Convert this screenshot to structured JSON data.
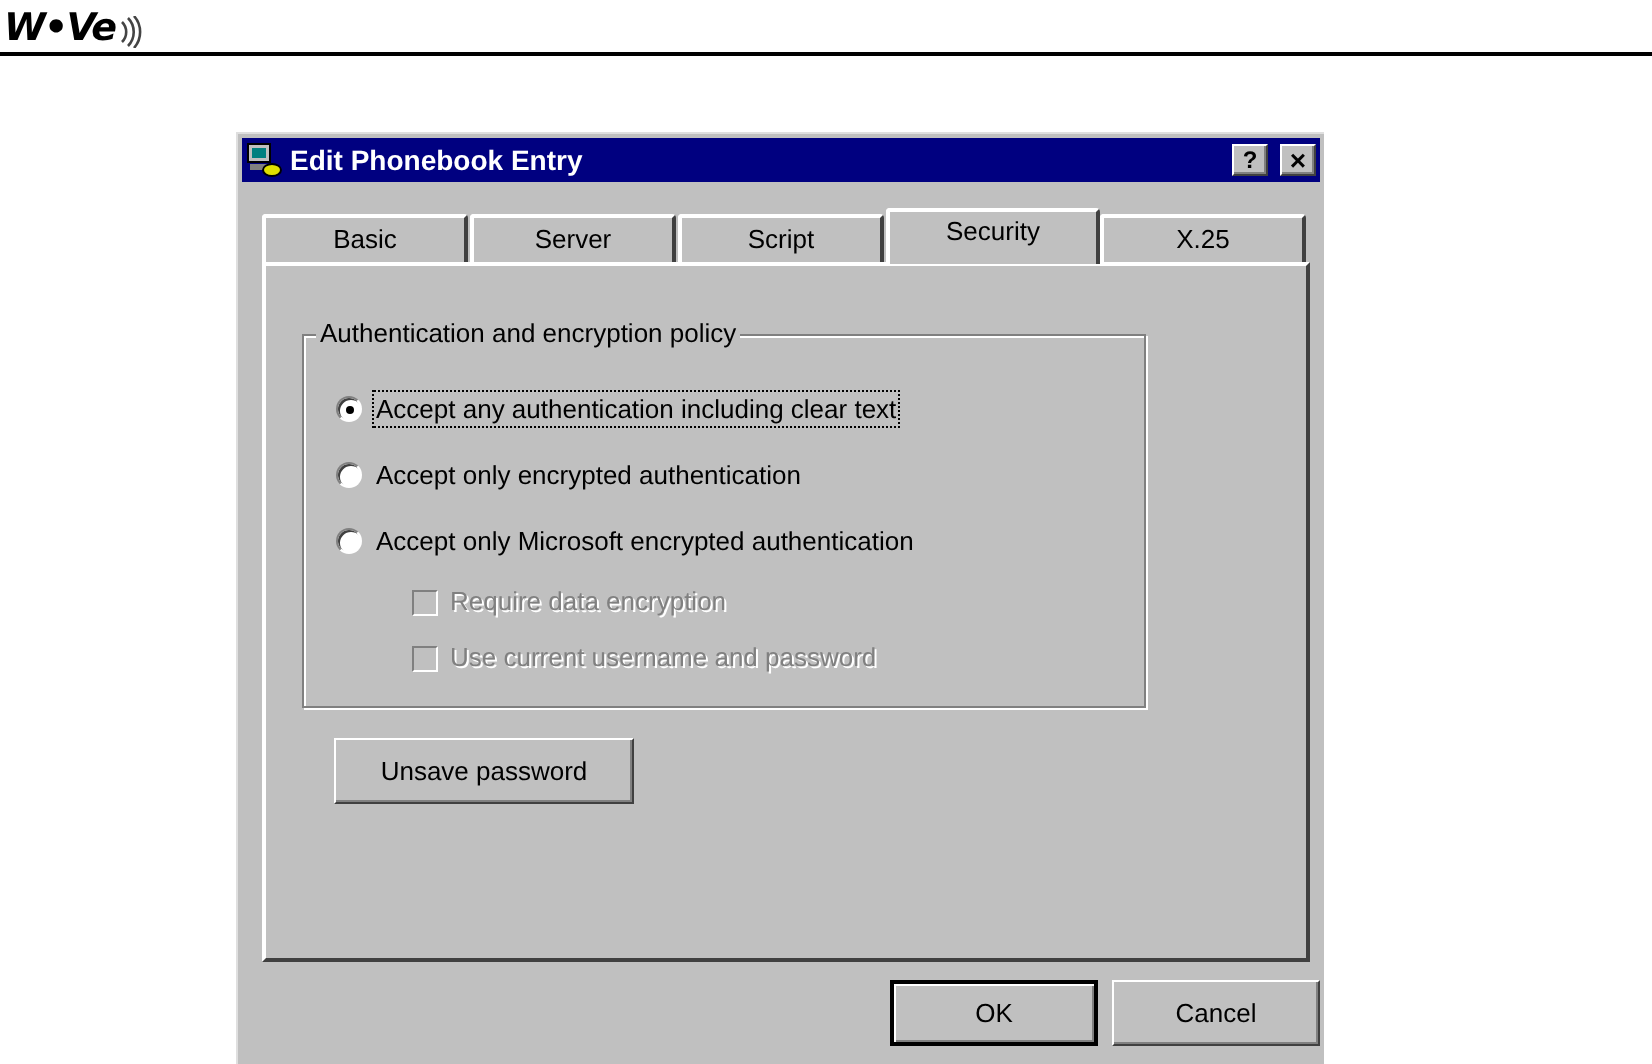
{
  "logo": {
    "text": "W•Ve"
  },
  "window": {
    "title": "Edit Phonebook Entry",
    "help_button": "?",
    "close_button": "×"
  },
  "tabs": [
    {
      "label": "Basic",
      "selected": false
    },
    {
      "label": "Server",
      "selected": false
    },
    {
      "label": "Script",
      "selected": false
    },
    {
      "label": "Security",
      "selected": true
    },
    {
      "label": "X.25",
      "selected": false
    }
  ],
  "group": {
    "title": "Authentication and encryption policy",
    "options": [
      {
        "kind": "radio",
        "label": "Accept any authentication including clear text",
        "selected": true,
        "focused": true
      },
      {
        "kind": "radio",
        "label": "Accept only encrypted authentication",
        "selected": false,
        "focused": false
      },
      {
        "kind": "radio",
        "label": "Accept only Microsoft encrypted authentication",
        "selected": false,
        "focused": false
      },
      {
        "kind": "checkbox",
        "label": "Require data encryption",
        "checked": false,
        "disabled": true
      },
      {
        "kind": "checkbox",
        "label": "Use current username and password",
        "checked": false,
        "disabled": true
      }
    ]
  },
  "unsave_button": {
    "label": "Unsave password"
  },
  "buttons": [
    {
      "label": "OK",
      "default": true
    },
    {
      "label": "Cancel",
      "default": false
    }
  ]
}
